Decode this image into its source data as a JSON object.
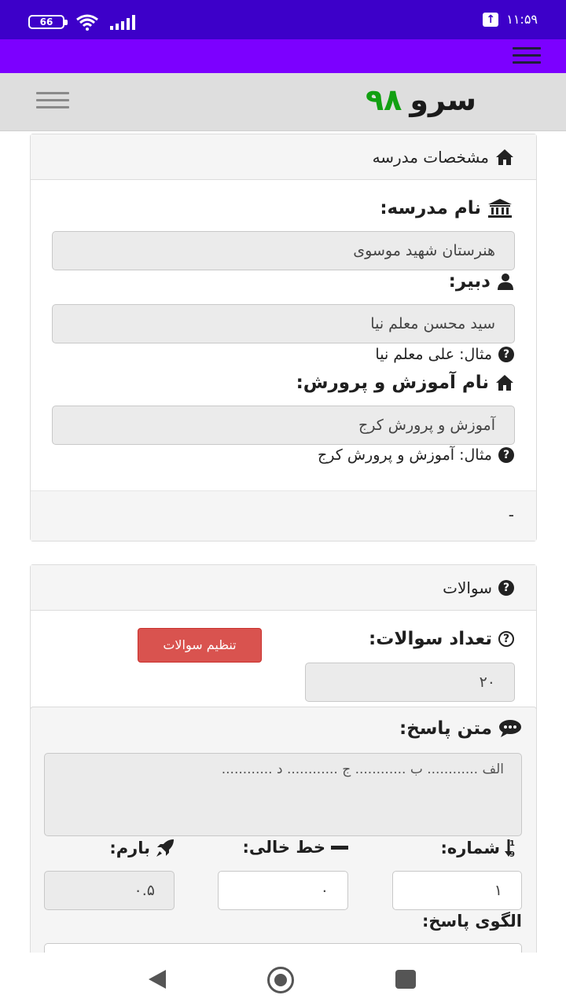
{
  "status_bar": {
    "battery": "66",
    "time": "۱۱:۵۹"
  },
  "header": {
    "logo_word": "سرو",
    "logo_number": "۹۸"
  },
  "school_panel": {
    "title": "مشخصات مدرسه",
    "school_name_label": "نام مدرسه:",
    "school_name_value": "هنرستان شهید موسوی",
    "teacher_label": "دبیر:",
    "teacher_value": "سید محسن معلم نیا",
    "teacher_hint": "مثال: علی معلم نیا",
    "education_label": "نام آموزش و پرورش:",
    "education_value": "آموزش و پرورش کرج",
    "education_hint": "مثال: آموزش و پرورش کرج",
    "footer_text": "-"
  },
  "questions_panel": {
    "title": "سوالات",
    "count_label": "تعداد سوالات:",
    "count_value": "۲۰",
    "setup_button": "تنظیم سوالات",
    "answer_text_label": "متن پاسخ:",
    "answer_text_value": "الف ............ ب ............ ج ............ د ............",
    "number_label": "شماره:",
    "number_value": "۱",
    "blank_line_label": "خط خالی:",
    "blank_line_value": "۰",
    "score_label": "بارم:",
    "score_value": "۰.۵",
    "answer_pattern_label": "الگوی پاسخ:"
  }
}
